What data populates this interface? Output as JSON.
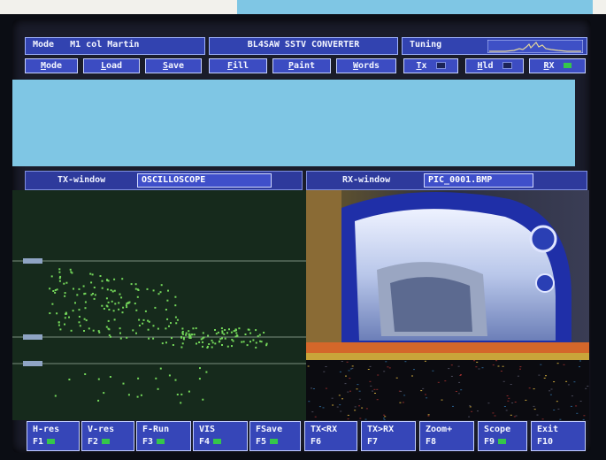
{
  "title_bar": {
    "mode_label": "Mode",
    "mode_value": "M1 col Martin",
    "app_title": "BL4SAW SSTV CONVERTER",
    "tuning_label": "Tuning"
  },
  "menu": [
    {
      "id": "mode",
      "label": "Mode",
      "hot": "M",
      "rest": "ode"
    },
    {
      "id": "load",
      "label": "Load",
      "hot": "L",
      "rest": "oad"
    },
    {
      "id": "save",
      "label": "Save",
      "hot": "S",
      "rest": "ave"
    },
    {
      "id": "fill",
      "label": "Fill",
      "hot": "F",
      "rest": "ill"
    },
    {
      "id": "paint",
      "label": "Paint",
      "hot": "P",
      "rest": "aint"
    },
    {
      "id": "words",
      "label": "Words",
      "hot": "W",
      "rest": "ords"
    },
    {
      "id": "tx",
      "label": "Tx",
      "hot": "T",
      "rest": "x"
    },
    {
      "id": "hld",
      "label": "Hld",
      "hot": "H",
      "rest": "ld"
    },
    {
      "id": "rx",
      "label": "RX",
      "hot": "R",
      "rest": "X"
    }
  ],
  "tx_window": {
    "label": "TX-window",
    "value": "OSCILLOSCOPE"
  },
  "rx_window": {
    "label": "RX-window",
    "value": "PIC_0001.BMP"
  },
  "function_keys": [
    {
      "id": "hres",
      "label": "H-res",
      "key": "F1"
    },
    {
      "id": "vres",
      "label": "V-res",
      "key": "F2"
    },
    {
      "id": "frun",
      "label": "F-Run",
      "key": "F3"
    },
    {
      "id": "vis",
      "label": "VIS",
      "key": "F4"
    },
    {
      "id": "fsave",
      "label": "FSave",
      "key": "F5"
    },
    {
      "id": "txrx",
      "label": "TX<RX",
      "key": "F6"
    },
    {
      "id": "rxtx",
      "label": "TX>RX",
      "key": "F7"
    },
    {
      "id": "zoom",
      "label": "Zoom+",
      "key": "F8"
    },
    {
      "id": "scope",
      "label": "Scope",
      "key": "F9"
    },
    {
      "id": "exit",
      "label": "Exit",
      "key": "F10"
    }
  ],
  "colors": {
    "panel_blue": "#3243b0",
    "cyan": "#7fc6e4",
    "scope_bg": "#162a1c",
    "trace_green": "#74d85a"
  }
}
